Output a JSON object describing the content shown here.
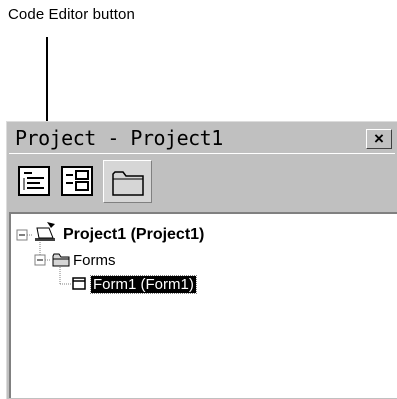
{
  "annotation": {
    "callout": "Code Editor button"
  },
  "window": {
    "title": "Project - Project1",
    "close_glyph": "×"
  },
  "toolbar": {
    "buttons": [
      {
        "name": "view-code",
        "icon": "code-editor-icon"
      },
      {
        "name": "view-object",
        "icon": "view-object-icon"
      },
      {
        "name": "toggle-folders",
        "icon": "folder-icon"
      }
    ]
  },
  "tree": {
    "project": {
      "label": "Project1 (Project1)",
      "expanded": true
    },
    "forms_folder": {
      "label": "Forms",
      "expanded": true
    },
    "form1": {
      "label": "Form1 (Form1)",
      "selected": true
    }
  }
}
